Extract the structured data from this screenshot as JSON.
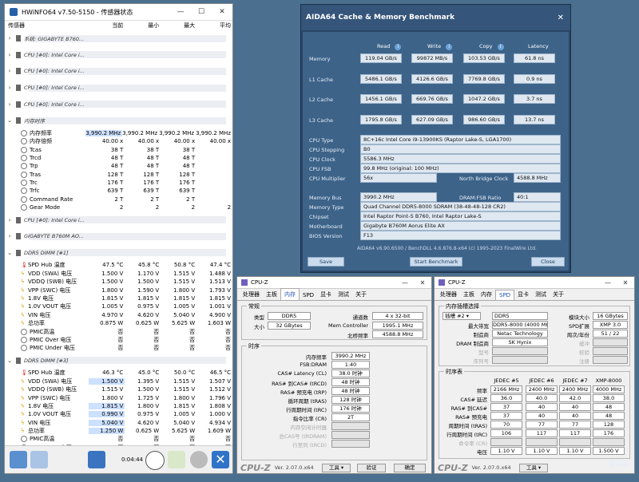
{
  "hwinfo": {
    "title": "HWiNFO64 v7.50-5150 - 传感器状态",
    "headers": [
      "传感器",
      "当前",
      "最小",
      "最大",
      "平均"
    ],
    "groups": {
      "g1": "系统: GIGABYTE B760...",
      "g2": "CPU [#0]: Intel Core i...",
      "g3": "CPU [#0]: Intel Core i...",
      "g4": "CPU [#0]: Intel Core i...",
      "g5": "CPU [#0]: Intel Core i...",
      "g6": "内存时序",
      "g7": "CPU [#0]: Intel Core i...",
      "g8": "GIGABYTE B760M AO...",
      "g9": "DDR5 DIMM [#1]",
      "g10": "DDR5 DIMM [#3]"
    },
    "timing_rows": [
      [
        "内存频率",
        "3,990.2 MHz",
        "3,990.2 MHz",
        "3,990.2 MHz",
        "3,990.2 MHz"
      ],
      [
        "内存倍频",
        "40.00 x",
        "40.00 x",
        "40.00 x",
        "40.00 x"
      ],
      [
        "Tcas",
        "38 T",
        "38 T",
        "38 T",
        ""
      ],
      [
        "Trcd",
        "48 T",
        "48 T",
        "48 T",
        ""
      ],
      [
        "Trp",
        "48 T",
        "48 T",
        "48 T",
        ""
      ],
      [
        "Tras",
        "128 T",
        "128 T",
        "128 T",
        ""
      ],
      [
        "Trc",
        "176 T",
        "176 T",
        "176 T",
        ""
      ],
      [
        "Trfc",
        "639 T",
        "639 T",
        "639 T",
        ""
      ],
      [
        "Command Rate",
        "2 T",
        "2 T",
        "2 T",
        ""
      ],
      [
        "Gear Mode",
        "2",
        "2",
        "2",
        "2"
      ]
    ],
    "dimm1_rows": [
      [
        "SPD Hub 温度",
        "47.5 °C",
        "45.8 °C",
        "50.8 °C",
        "47.4 °C"
      ],
      [
        "VDD (SWA) 电压",
        "1.500 V",
        "1.170 V",
        "1.515 V",
        "1.488 V"
      ],
      [
        "VDDQ (SWB) 电压",
        "1.500 V",
        "1.500 V",
        "1.515 V",
        "1.513 V"
      ],
      [
        "VPP (SWC) 电压",
        "1.800 V",
        "1.590 V",
        "1.800 V",
        "1.793 V"
      ],
      [
        "1.8V 电压",
        "1.815 V",
        "1.815 V",
        "1.815 V",
        "1.815 V"
      ],
      [
        "1.0V VOUT 电压",
        "1.005 V",
        "0.975 V",
        "1.005 V",
        "1.001 V"
      ],
      [
        "VIN 电压",
        "4.970 V",
        "4.620 V",
        "5.040 V",
        "4.900 V"
      ],
      [
        "总功率",
        "0.875 W",
        "0.625 W",
        "5.625 W",
        "1.603 W"
      ],
      [
        "PMIC高温",
        "否",
        "否",
        "否",
        "否"
      ],
      [
        "PMIC Over 电压",
        "否",
        "否",
        "否",
        "否"
      ],
      [
        "PMIC Under 电压",
        "否",
        "否",
        "否",
        "否"
      ]
    ],
    "dimm3_rows": [
      [
        "SPD Hub 温度",
        "46.3 °C",
        "45.0 °C",
        "50.0 °C",
        "46.5 °C"
      ],
      [
        "VDD (SWA) 电压",
        "1.500 V",
        "1.395 V",
        "1.515 V",
        "1.507 V"
      ],
      [
        "VDDQ (SWB) 电压",
        "1.515 V",
        "1.500 V",
        "1.515 V",
        "1.512 V"
      ],
      [
        "VPP (SWC) 电压",
        "1.800 V",
        "1.725 V",
        "1.800 V",
        "1.796 V"
      ],
      [
        "1.8V 电压",
        "1.815 V",
        "1.800 V",
        "1.815 V",
        "1.808 V"
      ],
      [
        "1.0V VOUT 电压",
        "0.990 V",
        "0.975 V",
        "1.005 V",
        "1.000 V"
      ],
      [
        "VIN 电压",
        "5.040 V",
        "4.620 V",
        "5.040 V",
        "4.934 V"
      ],
      [
        "总功率",
        "1.250 W",
        "0.625 W",
        "5.625 W",
        "1.609 W"
      ],
      [
        "PMIC高温",
        "否",
        "否",
        "否",
        "否"
      ],
      [
        "PMIC Over 电压",
        "否",
        "否",
        "否",
        "否"
      ],
      [
        "PMIC Under 电压",
        "否",
        "否",
        "否",
        "否"
      ]
    ],
    "timer": "0:04:44"
  },
  "aida": {
    "title": "AIDA64 Cache & Memory Benchmark",
    "cols": {
      "read": "Read",
      "write": "Write",
      "copy": "Copy",
      "latency": "Latency"
    },
    "bench": [
      {
        "label": "Memory",
        "read": "119.04 GB/s",
        "write": "99872 MB/s",
        "copy": "103.53 GB/s",
        "latency": "61.8 ns"
      },
      {
        "label": "L1 Cache",
        "read": "5486.1 GB/s",
        "write": "4126.6 GB/s",
        "copy": "7769.8 GB/s",
        "latency": "0.9 ns"
      },
      {
        "label": "L2 Cache",
        "read": "1456.1 GB/s",
        "write": "669.76 GB/s",
        "copy": "1047.2 GB/s",
        "latency": "3.7 ns"
      },
      {
        "label": "L3 Cache",
        "read": "1795.8 GB/s",
        "write": "627.09 GB/s",
        "copy": "986.60 GB/s",
        "latency": "13.7 ns"
      }
    ],
    "cpu_type_l": "CPU Type",
    "cpu_type": "8C+16c Intel Core i9-13900KS  (Raptor Lake-S, LGA1700)",
    "cpu_step_l": "CPU Stepping",
    "cpu_step": "B0",
    "cpu_clock_l": "CPU Clock",
    "cpu_clock": "5586.3 MHz",
    "cpu_fsb_l": "CPU FSB",
    "cpu_fsb": "99.8 MHz  (original: 100 MHz)",
    "cpu_mult_l": "CPU Multiplier",
    "cpu_mult": "56x",
    "nb_l": "North Bridge Clock",
    "nb": "4588.8 MHz",
    "mem_bus_l": "Memory Bus",
    "mem_bus": "3990.2 MHz",
    "dram_fsb_l": "DRAM:FSB Ratio",
    "dram_fsb": "40:1",
    "mem_type_l": "Memory Type",
    "mem_type": "Quad Channel DDR5-8000 SDRAM  (38-48-48-128 CR2)",
    "chipset_l": "Chipset",
    "chipset": "Intel Raptor Point-S B760, Intel Raptor Lake-S",
    "mobo_l": "Motherboard",
    "mobo": "Gigabyte B760M Aorus Elite AX",
    "bios_l": "BIOS Version",
    "bios": "F13",
    "footer": "AIDA64 v6.90.6500 / BenchDLL 4.6.876.8-x64  (c) 1995-2023 FinalWire Ltd.",
    "save": "Save",
    "start": "Start Benchmark",
    "close": "Close"
  },
  "cpuz1": {
    "title": "CPU-Z",
    "tabs": [
      "处理器",
      "主板",
      "内存",
      "SPD",
      "显卡",
      "测试",
      "关于"
    ],
    "general_lg": "常规",
    "type_l": "类型",
    "type": "DDR5",
    "size_l": "大小",
    "size": "32 GBytes",
    "chan_l": "通道数",
    "chan": "4 x 32-bit",
    "mc_l": "Mem Controller",
    "mc": "1995.1 MHz",
    "nb_l": "北桥频率",
    "nb": "4588.8 MHz",
    "timing_lg": "时序",
    "timings": [
      [
        "内存频率",
        "3990.2 MHz"
      ],
      [
        "FSB:DRAM",
        "1:40"
      ],
      [
        "CAS# Latency (CL)",
        "38.0 时钟"
      ],
      [
        "RAS# 到CAS# (tRCD)",
        "48 时钟"
      ],
      [
        "RAS# 预充电 (tRP)",
        "48 时钟"
      ],
      [
        "循环周期 (tRAS)",
        "128 时钟"
      ],
      [
        "行周期时间 (tRC)",
        "176 时钟"
      ],
      [
        "指令比率 (CR)",
        "2T"
      ]
    ],
    "gray": [
      "内存空闲计时器",
      "总CAS号 (tRDRAM)",
      "行至列 (tRCD)"
    ],
    "version": "Ver. 2.07.0.x64",
    "tools": "工具",
    "verify": "验证",
    "ok": "确定"
  },
  "cpuz2": {
    "title": "CPU-Z",
    "tabs": [
      "处理器",
      "主板",
      "内存",
      "SPD",
      "显卡",
      "测试",
      "关于"
    ],
    "slot_lg": "内存插槽选择",
    "slot": "插槽 #2",
    "slot_type": "DDR5",
    "modsize_l": "模块大小",
    "modsize": "16 GBytes",
    "maxbw_l": "最大带宽",
    "maxbw": "DDR5-8000 (4000 MHz)",
    "spdext_l": "SPD扩展",
    "spdext": "XMP 3.0",
    "mfr_l": "制造商",
    "mfr": "Netac Technology",
    "wk_l": "周次/年份",
    "wk": "51 / 22",
    "dram_l": "DRAM 制造商",
    "dram": "SK Hynix",
    "model_l": "型号",
    "buffered_l": "缓冲",
    "pn_l": "序列号",
    "corr_l": "校验",
    "reg_l": "注册",
    "timing_lg": "时序表",
    "heads": [
      "JEDEC #5",
      "JEDEC #6",
      "JEDEC #7",
      "XMP-8000"
    ],
    "trows": [
      [
        "频率",
        "2166 MHz",
        "2400 MHz",
        "2400 MHz",
        "4000 MHz"
      ],
      [
        "CAS# 延迟",
        "36.0",
        "40.0",
        "42.0",
        "38.0"
      ],
      [
        "RAS# 到CAS#",
        "37",
        "40",
        "40",
        "48"
      ],
      [
        "RAS# 预充电",
        "37",
        "40",
        "40",
        "48"
      ],
      [
        "周期时间 (tRAS)",
        "70",
        "77",
        "77",
        "128"
      ],
      [
        "行周期时间 (tRC)",
        "106",
        "117",
        "117",
        "176"
      ],
      [
        "命令率 (CR)",
        "",
        "",
        "",
        ""
      ],
      [
        "电压",
        "1.10 V",
        "1.10 V",
        "1.10 V",
        "1.500 V"
      ]
    ],
    "version": "Ver. 2.07.0.x64",
    "tools": "工具",
    "watermark": "值得买"
  }
}
